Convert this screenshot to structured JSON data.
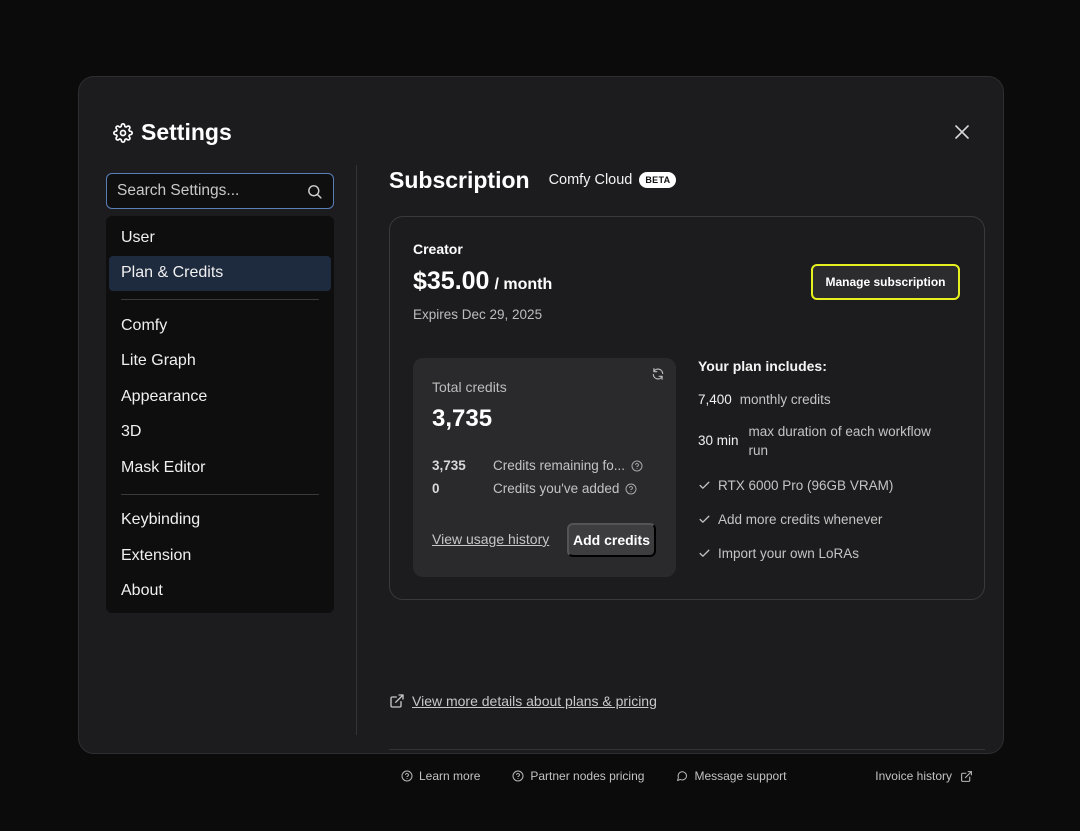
{
  "dialog": {
    "title": "Settings",
    "close_icon": "close-icon",
    "settings_icon": "gear-icon"
  },
  "sidebar": {
    "search_placeholder": "Search Settings...",
    "groups": [
      [
        "User",
        "Plan & Credits"
      ],
      [
        "Comfy",
        "Lite Graph",
        "Appearance",
        "3D",
        "Mask Editor"
      ],
      [
        "Keybinding",
        "Extension",
        "About"
      ]
    ],
    "active": "Plan & Credits"
  },
  "main": {
    "title": "Subscription",
    "product": "Comfy Cloud",
    "badge": "BETA",
    "plan": {
      "name": "Creator",
      "price": "$35.00",
      "period": "/ month",
      "expires": "Expires Dec 29, 2025",
      "manage_label": "Manage subscription"
    },
    "credits": {
      "label": "Total credits",
      "total": "3,735",
      "rows": [
        {
          "num": "3,735",
          "desc": "Credits remaining fo..."
        },
        {
          "num": "0",
          "desc": "Credits you've added"
        }
      ],
      "view_usage": "View usage history",
      "add_label": "Add credits"
    },
    "includes": {
      "title": "Your plan includes:",
      "items": [
        {
          "val": "7,400",
          "desc": "monthly credits"
        },
        {
          "val": "30 min",
          "desc": "max duration of each workflow run"
        }
      ],
      "checks": [
        "RTX 6000 Pro (96GB VRAM)",
        "Add more credits whenever",
        "Import your own LoRAs"
      ]
    },
    "more_details": "View more details about plans & pricing",
    "footer": {
      "learn_more": "Learn more",
      "partner_pricing": "Partner nodes pricing",
      "message_support": "Message support",
      "invoice_history": "Invoice history"
    }
  },
  "colors": {
    "accent_highlight": "#e6f01e",
    "active_nav": "#1e2a3e",
    "search_border": "#5a7fb8"
  }
}
